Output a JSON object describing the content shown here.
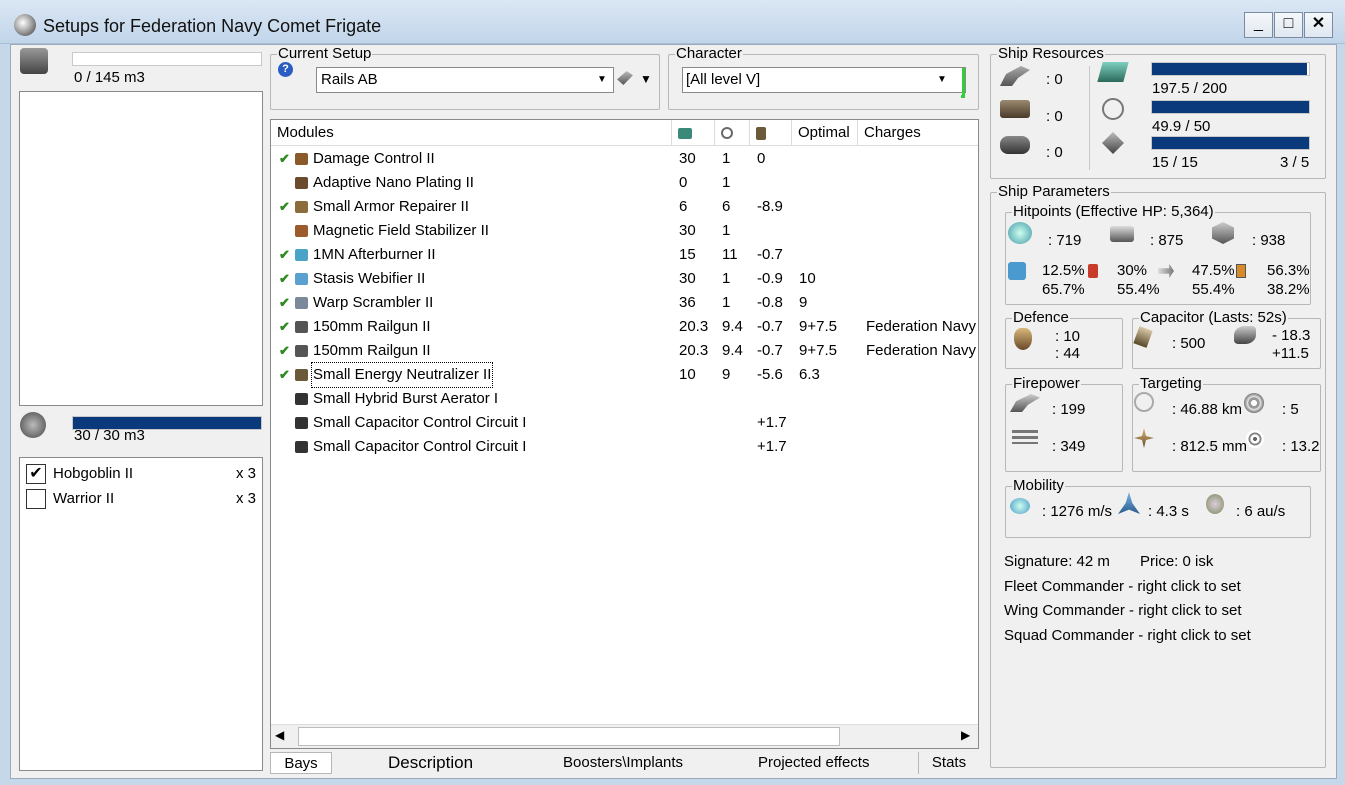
{
  "window": {
    "title": "Setups for Federation Navy Comet Frigate",
    "buttons": [
      "_",
      "□",
      "✕"
    ]
  },
  "cargo": {
    "capacity": "0 / 145 m3",
    "fill": 0
  },
  "drones": {
    "capacity": "30 / 30 m3",
    "fill": 1.0,
    "items": [
      {
        "name": "Hobgoblin II",
        "qty": "x 3",
        "checked": "✔"
      },
      {
        "name": "Warrior II",
        "qty": "x 3",
        "checked": ""
      }
    ]
  },
  "current_setup": {
    "label": "Current Setup",
    "value": "Rails AB"
  },
  "character": {
    "label": "Character",
    "value": "[All level V]"
  },
  "modules": {
    "headers": [
      "Modules",
      "",
      "",
      "",
      "Optimal",
      "Charges"
    ],
    "rows": [
      {
        "check": "✔",
        "name": "Damage Control II",
        "cpu": "30",
        "pg": "1",
        "cap": "0",
        "opt": "",
        "charge": "",
        "color": "#8a5a2b"
      },
      {
        "check": "",
        "name": "Adaptive Nano Plating II",
        "cpu": "0",
        "pg": "1",
        "cap": "",
        "opt": "",
        "charge": "",
        "color": "#6b4a2e"
      },
      {
        "check": "✔",
        "name": "Small Armor Repairer II",
        "cpu": "6",
        "pg": "6",
        "cap": "-8.9",
        "opt": "",
        "charge": "",
        "color": "#8a6d3b"
      },
      {
        "check": "",
        "name": "Magnetic Field Stabilizer II",
        "cpu": "30",
        "pg": "1",
        "cap": "",
        "opt": "",
        "charge": "",
        "color": "#9b5b2c"
      },
      {
        "check": "✔",
        "name": "1MN Afterburner II",
        "cpu": "15",
        "pg": "11",
        "cap": "-0.7",
        "opt": "",
        "charge": "",
        "color": "#4aa4c8"
      },
      {
        "check": "✔",
        "name": "Stasis Webifier II",
        "cpu": "30",
        "pg": "1",
        "cap": "-0.9",
        "opt": "10",
        "charge": "",
        "color": "#5aa0d0"
      },
      {
        "check": "✔",
        "name": "Warp Scrambler II",
        "cpu": "36",
        "pg": "1",
        "cap": "-0.8",
        "opt": "9",
        "charge": "",
        "color": "#7a8a9a"
      },
      {
        "check": "✔",
        "name": "150mm Railgun II",
        "cpu": "20.3",
        "pg": "9.4",
        "cap": "-0.7",
        "opt": "9+7.5",
        "charge": "Federation Navy",
        "color": "#555"
      },
      {
        "check": "✔",
        "name": "150mm Railgun II",
        "cpu": "20.3",
        "pg": "9.4",
        "cap": "-0.7",
        "opt": "9+7.5",
        "charge": "Federation Navy",
        "color": "#555"
      },
      {
        "check": "✔",
        "name": "Small Energy Neutralizer II",
        "cpu": "10",
        "pg": "9",
        "cap": "-5.6",
        "opt": "6.3",
        "charge": "",
        "color": "#6b5a3a"
      },
      {
        "check": "",
        "name": "Small Hybrid Burst Aerator I",
        "cpu": "",
        "pg": "",
        "cap": "",
        "opt": "",
        "charge": "",
        "color": "#333"
      },
      {
        "check": "",
        "name": "Small Capacitor Control Circuit I",
        "cpu": "",
        "pg": "",
        "cap": "+1.7",
        "opt": "",
        "charge": "",
        "color": "#333"
      },
      {
        "check": "",
        "name": "Small Capacitor Control Circuit I",
        "cpu": "",
        "pg": "",
        "cap": "+1.7",
        "opt": "",
        "charge": "",
        "color": "#333"
      }
    ]
  },
  "tabs": [
    "Bays",
    "Description",
    "Boosters\\Implants",
    "Projected effects",
    "Stats"
  ],
  "resources": {
    "label": "Ship Resources",
    "turret": ": 0",
    "launcher": ": 0",
    "calibration": ": 0",
    "cpu": {
      "text": "197.5 / 200",
      "fill": 0.9875
    },
    "powergrid": {
      "text": "49.9 / 50",
      "fill": 0.998
    },
    "drone_bw": {
      "text": "15 / 15",
      "fill": 1.0
    },
    "drones_active": "3 / 5"
  },
  "parameters": {
    "label": "Ship Parameters",
    "hitpoints": {
      "label": "Hitpoints (Effective HP: 5,364)",
      "shield": ": 719",
      "armor": ": 875",
      "structure": ": 938",
      "res_top": [
        "12.5%",
        "30%",
        "47.5%",
        "56.3%"
      ],
      "res_bottom": [
        "65.7%",
        "55.4%",
        "55.4%",
        "38.2%"
      ]
    },
    "defence": {
      "label": "Defence",
      "v1": ": 10",
      "v2": ": 44"
    },
    "capacitor": {
      "label": "Capacitor (Lasts: 52s)",
      "cap": ": 500",
      "d1": "- 18.3",
      "d2": "+11.5"
    },
    "firepower": {
      "label": "Firepower",
      "v1": ": 199",
      "v2": ": 349"
    },
    "targeting": {
      "label": "Targeting",
      "range": ": 46.88 km",
      "targets": ": 5",
      "sig": ": 812.5 mm",
      "scan": ": 13.2"
    },
    "mobility": {
      "label": "Mobility",
      "speed": ": 1276 m/s",
      "align": ": 4.3 s",
      "warp": ": 6 au/s"
    },
    "signature": "Signature: 42 m",
    "price": "Price: 0 isk",
    "fleet": "Fleet Commander - right click to set",
    "wing": "Wing Commander - right click to set",
    "squad": "Squad Commander - right click to set"
  },
  "colors": {
    "bar": "#0b3a7c",
    "check": "#2c8a1e",
    "title_bg": "#c5d8ea"
  }
}
